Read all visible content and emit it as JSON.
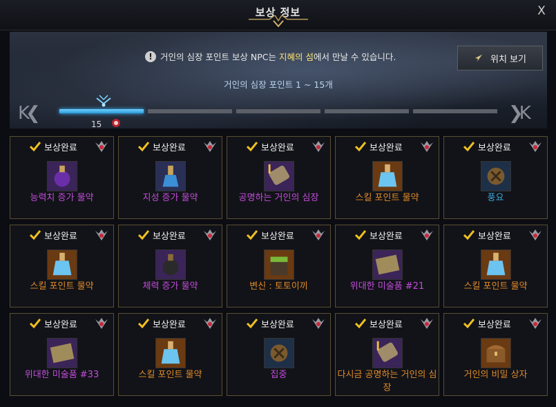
{
  "window": {
    "title": "보상 정보",
    "close_label": "X"
  },
  "banner": {
    "notice_pre": "거인의 심장 포인트 보상 NPC는 ",
    "notice_highlight": "지혜의 섬",
    "notice_post": "에서 만날 수 있습니다.",
    "notice_icon": "!",
    "location_button": "위치 보기",
    "range_text": "거인의 심장 포인트 1 ~ 15개"
  },
  "progress": {
    "nav_left": "K❮",
    "nav_right": "❯K",
    "points": "15",
    "active_segment": 1,
    "total_segments": 5
  },
  "colors": {
    "purple": "#c24cdc",
    "orange": "#e08a28",
    "blue": "#3aa8e0",
    "border": "#5b4e33"
  },
  "rewards": [
    {
      "status": "보상완료",
      "name": "능력치 증가 물약",
      "grade": "purple",
      "icon": "purple-potion-icon"
    },
    {
      "status": "보상완료",
      "name": "지성 증가 물약",
      "grade": "purple",
      "icon": "blue-potion-icon"
    },
    {
      "status": "보상완료",
      "name": "공명하는 거인의 심장",
      "grade": "purple",
      "icon": "scroll-icon"
    },
    {
      "status": "보상완료",
      "name": "스킬 포인트 물약",
      "grade": "orange",
      "icon": "skill-potion-icon"
    },
    {
      "status": "보상완료",
      "name": "풍요",
      "grade": "blue",
      "icon": "rune-icon"
    },
    {
      "status": "보상완료",
      "name": "스킬 포인트 물약",
      "grade": "orange",
      "icon": "skill-potion-icon"
    },
    {
      "status": "보상완료",
      "name": "체력 증가 물약",
      "grade": "purple",
      "icon": "dark-potion-icon"
    },
    {
      "status": "보상완료",
      "name": "변신 : 토토이끼",
      "grade": "orange",
      "icon": "moss-box-icon"
    },
    {
      "status": "보상완료",
      "name": "위대한 미술품 #21",
      "grade": "purple",
      "icon": "painting-icon"
    },
    {
      "status": "보상완료",
      "name": "스킬 포인트 물약",
      "grade": "orange",
      "icon": "skill-potion-icon"
    },
    {
      "status": "보상완료",
      "name": "위대한 미술품 #33",
      "grade": "purple",
      "icon": "painting-icon"
    },
    {
      "status": "보상완료",
      "name": "스킬 포인트 물약",
      "grade": "orange",
      "icon": "skill-potion-icon"
    },
    {
      "status": "보상완료",
      "name": "집중",
      "grade": "purple",
      "icon": "rune-icon"
    },
    {
      "status": "보상완료",
      "name": "다시금 공명하는 거인의 심장",
      "grade": "orange",
      "icon": "scroll-icon"
    },
    {
      "status": "보상완료",
      "name": "거인의 비밀 상자",
      "grade": "orange",
      "icon": "chest-icon"
    }
  ]
}
